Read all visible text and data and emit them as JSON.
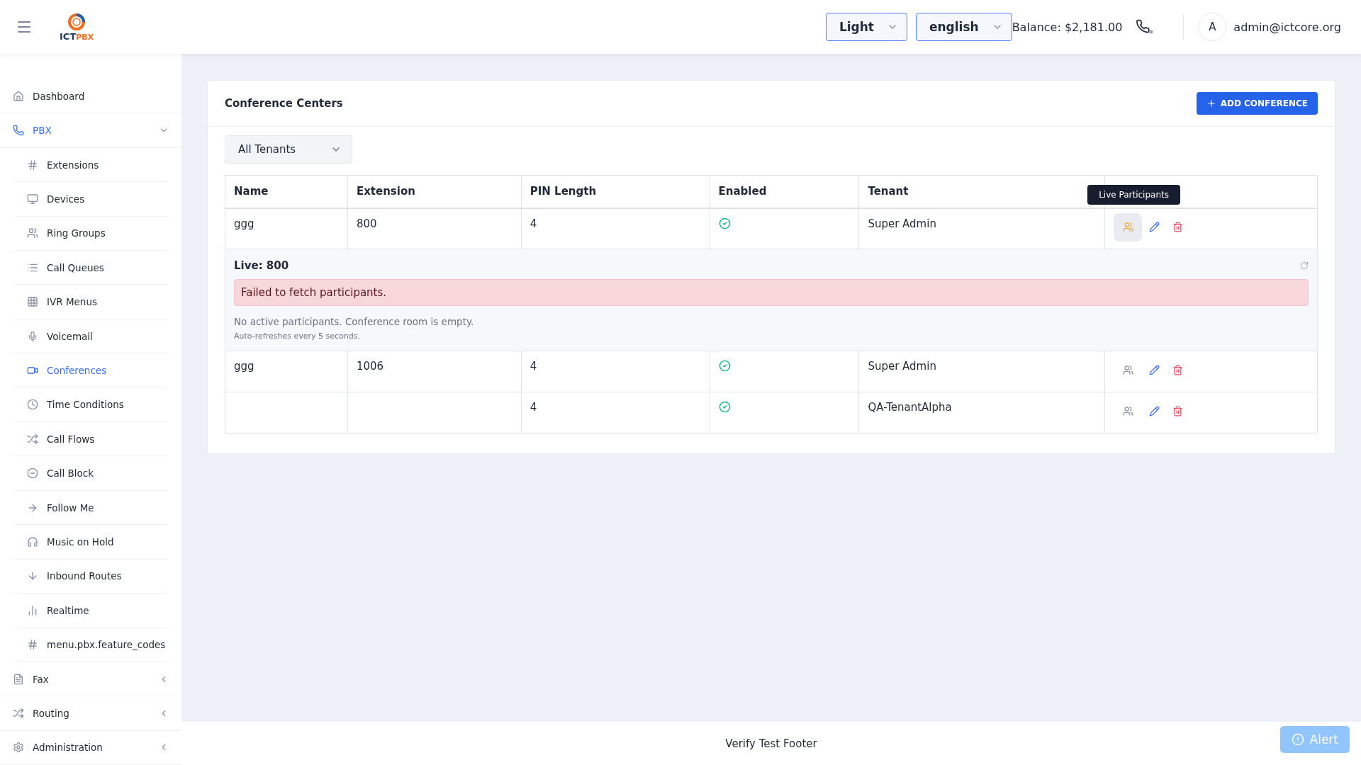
{
  "header": {
    "logo": {
      "main": "ICT",
      "accent": "PBX"
    },
    "theme_select": "Light",
    "language_select": "english",
    "balance": "Balance: $2,181.00",
    "avatar": "A",
    "email": "admin@ictcore.org"
  },
  "sidebar": {
    "items": [
      {
        "label": "Dashboard",
        "selected": false
      },
      {
        "label": "PBX",
        "selected": true,
        "expanded": true,
        "children": [
          {
            "label": "Extensions",
            "selected": false
          },
          {
            "label": "Devices",
            "selected": false
          },
          {
            "label": "Ring Groups",
            "selected": false
          },
          {
            "label": "Call Queues",
            "selected": false
          },
          {
            "label": "IVR Menus",
            "selected": false
          },
          {
            "label": "Voicemail",
            "selected": false
          },
          {
            "label": "Conferences",
            "selected": true
          },
          {
            "label": "Time Conditions",
            "selected": false
          },
          {
            "label": "Call Flows",
            "selected": false
          },
          {
            "label": "Call Block",
            "selected": false
          },
          {
            "label": "Follow Me",
            "selected": false
          },
          {
            "label": "Music on Hold",
            "selected": false
          },
          {
            "label": "Inbound Routes",
            "selected": false
          },
          {
            "label": "Realtime",
            "selected": false
          },
          {
            "label": "menu.pbx.feature_codes",
            "selected": false
          }
        ]
      },
      {
        "label": "Fax",
        "selected": false,
        "expanded": false
      },
      {
        "label": "Routing",
        "selected": false,
        "expanded": false
      },
      {
        "label": "Administration",
        "selected": false,
        "expanded": false
      }
    ]
  },
  "card": {
    "title": "Conference Centers",
    "add_button": "ADD CONFERENCE",
    "tenant_filter": "All Tenants",
    "table": {
      "columns": [
        "Name",
        "Extension",
        "PIN Length",
        "Enabled",
        "Tenant"
      ],
      "rows": [
        {
          "name": "ggg",
          "extension": "800",
          "pin_length": "4",
          "enabled": true,
          "tenant": "Super Admin",
          "participants_active": true,
          "live_panel": {
            "title": "Live: 800",
            "error": "Failed to fetch participants.",
            "message": "No active participants. Conference room is empty.",
            "note": "Auto-refreshes every 5 seconds."
          }
        },
        {
          "name": "ggg",
          "extension": "1006",
          "pin_length": "4",
          "enabled": true,
          "tenant": "Super Admin",
          "participants_active": false
        },
        {
          "name": "",
          "extension": "",
          "pin_length": "4",
          "enabled": true,
          "tenant": "QA-TenantAlpha",
          "participants_active": false
        }
      ]
    },
    "tooltip": "Live Participants"
  },
  "footer": "Verify Test Footer",
  "alert_button": "Alert"
}
